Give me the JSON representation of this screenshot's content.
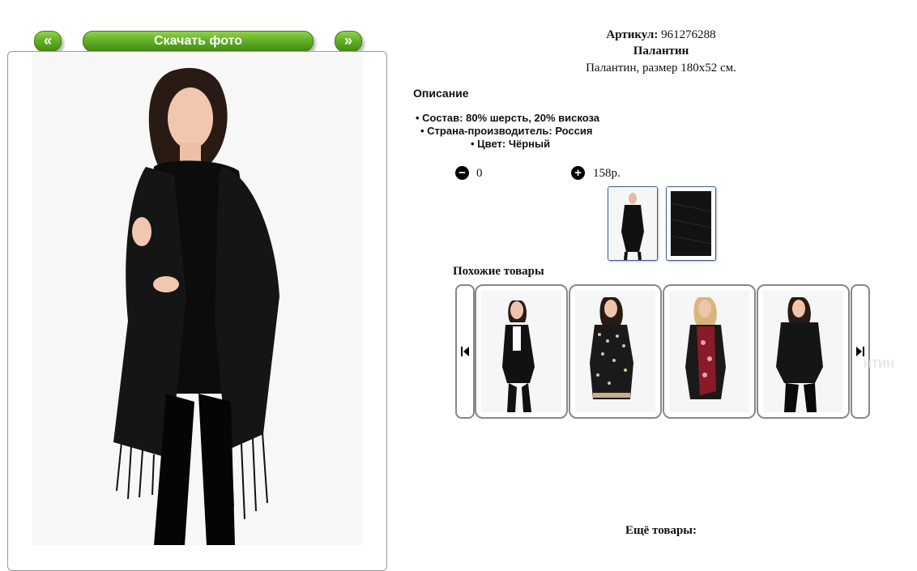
{
  "nav": {
    "prev_label": "«",
    "download_label": "Скачать фото",
    "next_label": "»"
  },
  "product": {
    "sku_label": "Артикул:",
    "sku_value": "961276288",
    "name": "Палантин",
    "subtitle": "Палантин, размер 180x52 см."
  },
  "description": {
    "title": "Описание",
    "bullets": [
      "Состав: 80% шерсть, 20% вискоза",
      "Страна-производитель: Россия",
      "Цвет: Чёрный"
    ]
  },
  "cart": {
    "quantity": "0",
    "price": "158р."
  },
  "similar": {
    "title": "Похожие товары",
    "faded_label": "нтин"
  },
  "more": {
    "title": "Ещё товары:"
  },
  "icons": {
    "minus": "minus-circle-icon",
    "plus": "plus-circle-icon",
    "prev": "skip-previous-icon",
    "next": "skip-next-icon"
  },
  "colors": {
    "button_green": "#63b026",
    "thumb_border": "#3b5b8a",
    "link_green": "#2a8a2a"
  }
}
